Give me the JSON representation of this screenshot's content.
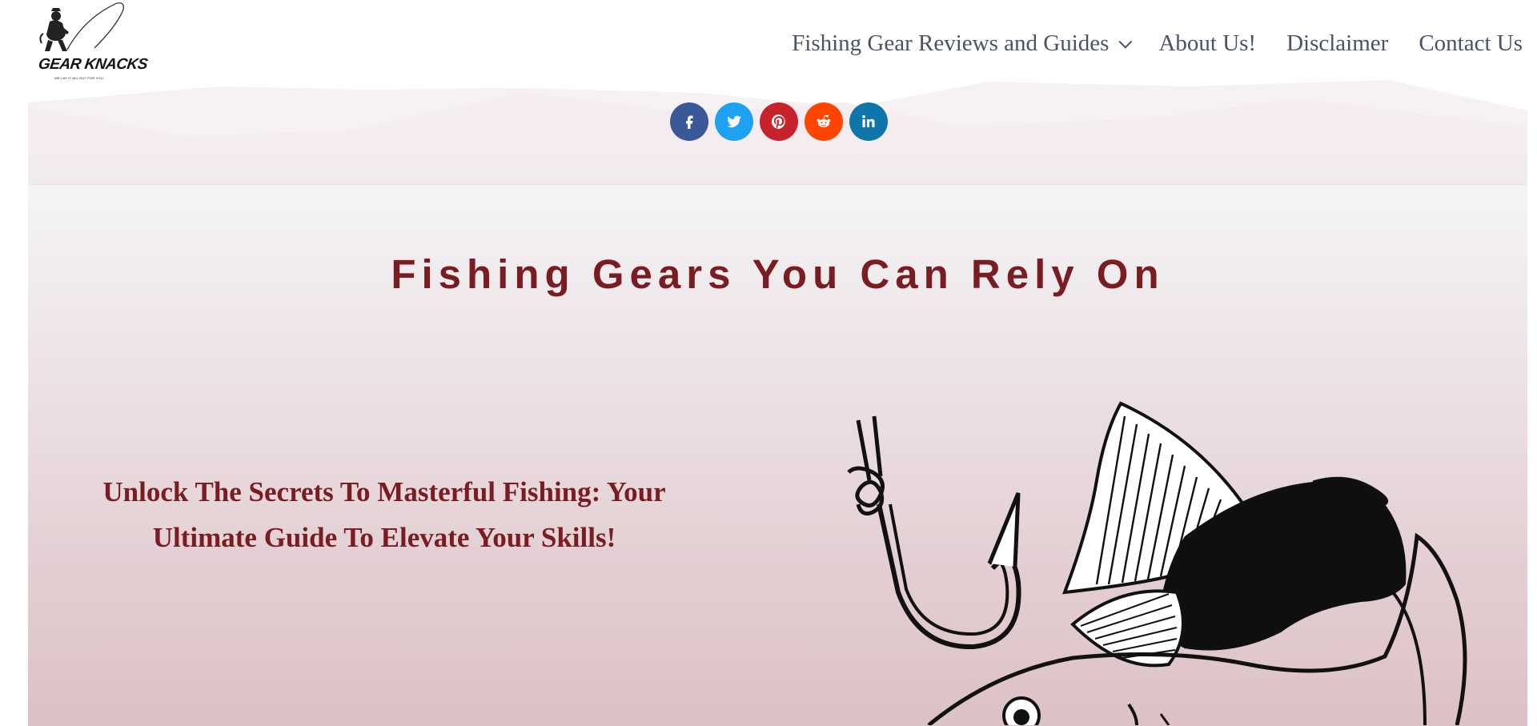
{
  "brand": {
    "name": "GEAR KNACKS",
    "tagline": "WE LAY IT ALL OUT FOR YOU"
  },
  "nav": {
    "items": [
      {
        "label": "Fishing Gear Reviews and Guides",
        "has_dropdown": true
      },
      {
        "label": "About Us!"
      },
      {
        "label": "Disclaimer"
      },
      {
        "label": "Contact Us"
      }
    ]
  },
  "social": [
    {
      "name": "facebook",
      "color": "#3b5998"
    },
    {
      "name": "twitter",
      "color": "#1da1f2"
    },
    {
      "name": "pinterest",
      "color": "#c8232c"
    },
    {
      "name": "reddit",
      "color": "#ff4500"
    },
    {
      "name": "linkedin",
      "color": "#0e76a8"
    }
  ],
  "hero": {
    "title": "Fishing Gears You Can Rely On",
    "subtitle": "Unlock The Secrets To Masterful Fishing: Your Ultimate Guide To Elevate Your Skills!"
  },
  "colors": {
    "accent": "#7a1d22",
    "nav_text": "#4a5366"
  }
}
